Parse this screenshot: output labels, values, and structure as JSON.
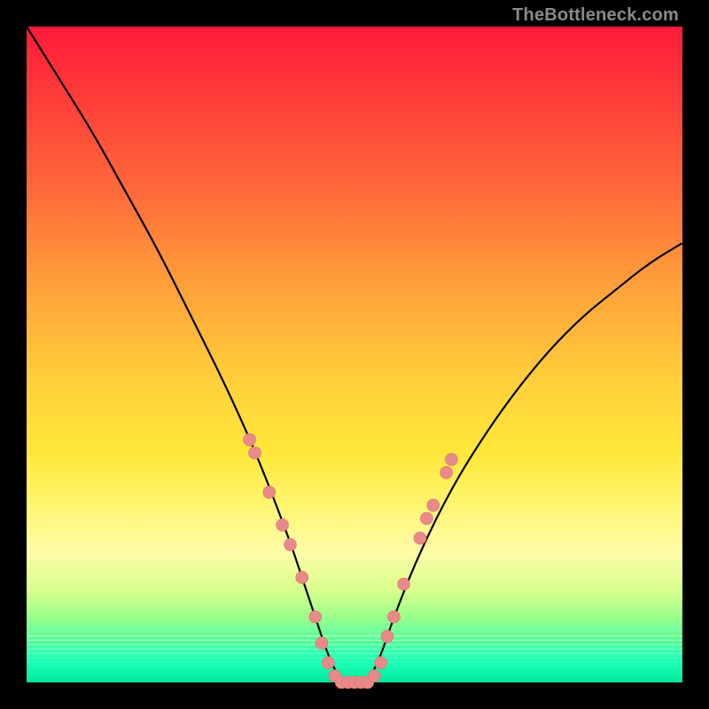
{
  "watermark": "TheBottleneck.com",
  "domain": "Chart",
  "chart_data": {
    "type": "line",
    "title": "",
    "xlabel": "",
    "ylabel": "",
    "xlim": [
      0,
      100
    ],
    "ylim": [
      0,
      100
    ],
    "curve": {
      "description": "V-shaped bottleneck curve; y is relative bottleneck % (0 at bottom, 100 at top)",
      "x": [
        0,
        5,
        10,
        15,
        20,
        25,
        30,
        35,
        40,
        42,
        44,
        46,
        48,
        50,
        52,
        54,
        56,
        60,
        65,
        70,
        75,
        80,
        85,
        90,
        95,
        100
      ],
      "y": [
        100,
        92,
        84,
        75,
        66,
        56,
        46,
        35,
        22,
        16,
        10,
        4,
        0,
        0,
        0,
        4,
        10,
        20,
        30,
        38,
        45,
        51,
        56,
        60,
        64,
        67
      ]
    },
    "marker_points": {
      "description": "salmon-pink sample dots along the lower part of the curve",
      "points": [
        {
          "x": 34.0,
          "y": 37
        },
        {
          "x": 34.8,
          "y": 35
        },
        {
          "x": 37.0,
          "y": 29
        },
        {
          "x": 39.0,
          "y": 24
        },
        {
          "x": 40.2,
          "y": 21
        },
        {
          "x": 42.0,
          "y": 16
        },
        {
          "x": 44.0,
          "y": 10
        },
        {
          "x": 45.0,
          "y": 6
        },
        {
          "x": 46.0,
          "y": 3
        },
        {
          "x": 47.0,
          "y": 1
        },
        {
          "x": 48.0,
          "y": 0
        },
        {
          "x": 49.0,
          "y": 0
        },
        {
          "x": 50.0,
          "y": 0
        },
        {
          "x": 51.0,
          "y": 0
        },
        {
          "x": 52.0,
          "y": 0
        },
        {
          "x": 53.0,
          "y": 1
        },
        {
          "x": 54.0,
          "y": 3
        },
        {
          "x": 55.0,
          "y": 7
        },
        {
          "x": 56.0,
          "y": 10
        },
        {
          "x": 57.5,
          "y": 15
        },
        {
          "x": 60.0,
          "y": 22
        },
        {
          "x": 61.0,
          "y": 25
        },
        {
          "x": 62.0,
          "y": 27
        },
        {
          "x": 64.0,
          "y": 32
        },
        {
          "x": 64.8,
          "y": 34
        }
      ]
    },
    "gradient_stops": [
      {
        "pos": 0.0,
        "color": "#ff1a3a"
      },
      {
        "pos": 0.55,
        "color": "#ffd23a"
      },
      {
        "pos": 0.8,
        "color": "#fffca8"
      },
      {
        "pos": 0.94,
        "color": "#4cffa8"
      },
      {
        "pos": 1.0,
        "color": "#00e89c"
      }
    ]
  }
}
